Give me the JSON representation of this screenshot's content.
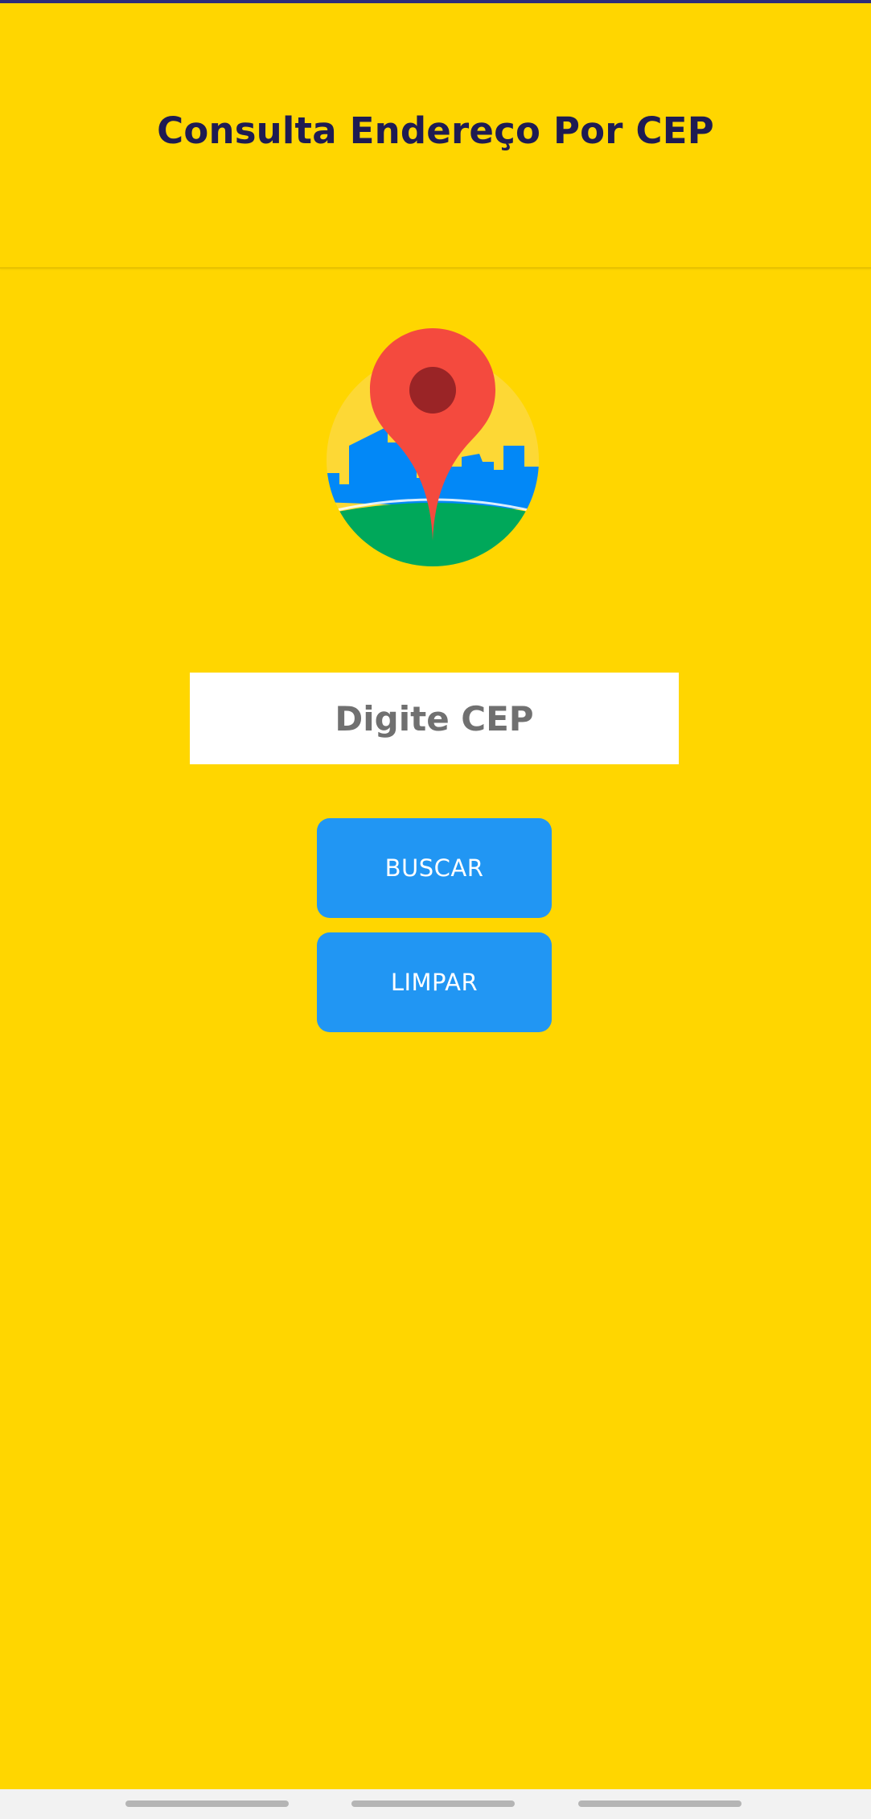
{
  "header": {
    "title": "Consulta Endereço Por CEP"
  },
  "logo": {
    "icon": "map-pin-city-icon",
    "colors": {
      "background_circle": "#FDD835",
      "sky_buildings": "#0288F7",
      "ground": "#00A85A",
      "pin": "#F44A3E",
      "pin_dot": "#9A2426"
    }
  },
  "search": {
    "placeholder": "Digite CEP",
    "value": ""
  },
  "buttons": {
    "search_label": "BUSCAR",
    "clear_label": "LIMPAR"
  },
  "theme": {
    "background": "#FFD600",
    "title_color": "#1E1B52",
    "button_color": "#2196F3",
    "button_text_color": "#FFFFFF"
  }
}
